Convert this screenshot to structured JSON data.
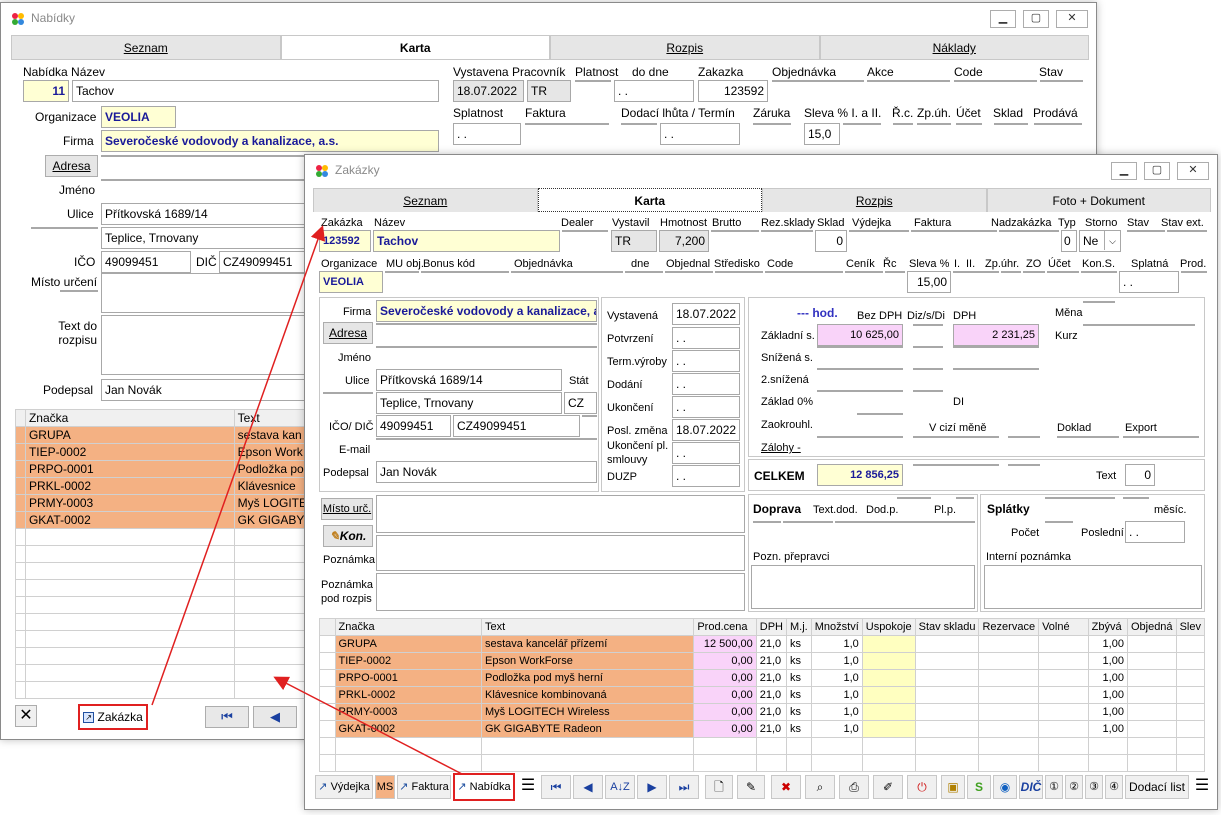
{
  "win1": {
    "title": "Nabídky",
    "tabs": [
      "Seznam",
      "Karta",
      "Rozpis",
      "Náklady"
    ],
    "lbl": {
      "nabidka_nazev": "Nabídka Název",
      "organizace": "Organizace",
      "firma": "Firma",
      "adresa": "Adresa",
      "jmeno": "Jméno",
      "ulice": "Ulice",
      "ico": "IČO",
      "dic": "DIČ",
      "misto": "Místo určení",
      "text_do": "Text do rozpisu",
      "podepsal": "Podepsal",
      "vystavena": "Vystavena",
      "pracovnik": "Pracovník",
      "platnost": "Platnost",
      "do_dne": "do dne",
      "zakazka": "Zakazka",
      "objednavka": "Objednávka",
      "akce": "Akce",
      "code": "Code",
      "stav": "Stav",
      "splatnost": "Splatnost",
      "faktura": "Faktura",
      "dodaci": "Dodací lhůta / Termín",
      "zaruka": "Záruka",
      "sleva": "Sleva % I. a II.",
      "rc": "Ř.c.",
      "zpuh": "Zp.úh.",
      "ucet": "Účet",
      "sklad": "Sklad",
      "prodava": "Prodává"
    },
    "val": {
      "cislo": "11",
      "nazev": "Tachov",
      "organizace": "VEOLIA",
      "firma": "Severočeské vodovody a kanalizace, a.s.",
      "ulice": "Přítkovská 1689/14",
      "mesto": "Teplice, Trnovany",
      "ico": "49099451",
      "dic": "CZ49099451",
      "podepsal": "Jan Novák",
      "vystavena": "18.07.2022",
      "pracovnik": "TR",
      "platnost": ". .",
      "do_dne": ". .",
      "zakazka": "123592",
      "splatnost": ". .",
      "dodaci": ". .",
      "sleva": "15,0"
    },
    "grid_head": [
      "Značka",
      "Text"
    ],
    "rows": [
      [
        "GRUPA",
        "sestava kan"
      ],
      [
        "TIEP-0002",
        "Epson Work"
      ],
      [
        "PRPO-0001",
        "Podložka po"
      ],
      [
        "PRKL-0002",
        "Klávesnice"
      ],
      [
        "PRMY-0003",
        "Myš LOGITE"
      ],
      [
        "GKAT-0002",
        "GK  GIGABY"
      ]
    ],
    "zakazka_btn": "Zakázka"
  },
  "win2": {
    "title": "Zakázky",
    "tabs": [
      "Seznam",
      "Karta",
      "Rozpis",
      "Foto + Dokument"
    ],
    "head1": {
      "zakazka": "Zakázka",
      "nazev": "Název",
      "dealer": "Dealer",
      "vystavil": "Vystavil",
      "hmotnost": "Hmotnost",
      "brutto": "Brutto",
      "rezsklady": "Rez.sklady",
      "sklad": "Sklad",
      "vydejka": "Výdejka",
      "faktura": "Faktura",
      "nadzakazka": "Nadzakázka",
      "typ": "Typ",
      "storno": "Storno",
      "stav": "Stav",
      "stavext": "Stav ext."
    },
    "val1": {
      "zakazka": "123592",
      "nazev": "Tachov",
      "vystavil": "TR",
      "hmotnost": "7,200",
      "sklad": "0",
      "typ": "0",
      "storno": "Ne"
    },
    "head2": {
      "organizace": "Organizace",
      "mu": "MU obj.",
      "bonus": "Bonus kód",
      "objednavka": "Objednávka",
      "dne": "dne",
      "objednal": "Objednal",
      "stredisko": "Středisko",
      "code": "Code",
      "cenik": "Ceník",
      "rc": "Řc",
      "sleva": "Sleva %",
      "i": "I.",
      "ii": "II.",
      "zpuhr": "Zp.úhr.",
      "zo": "ZO",
      "ucet": "Účet",
      "konsym": "Kon.S.",
      "splatna": "Splatná",
      "prod": "Prod."
    },
    "val2": {
      "organizace": "VEOLIA",
      "sleva": "15,00",
      "splatna": ". ."
    },
    "left": {
      "firma_l": "Firma",
      "firma": "Severočeské vodovody a kanalizace, a.",
      "adresa": "Adresa",
      "jmeno": "Jméno",
      "ulice_l": "Ulice",
      "ulice": "Přítkovská 1689/14",
      "stat": "Stát",
      "mesto": "Teplice, Trnovany",
      "statv": "CZ",
      "ico_l": "IČO/ DIČ",
      "ico": "49099451",
      "dic": "CZ49099451",
      "email": "E-mail",
      "podepsal_l": "Podepsal",
      "podepsal": "Jan Novák"
    },
    "dates": [
      [
        "Vystavená",
        "18.07.2022"
      ],
      [
        "Potvrzení",
        ". ."
      ],
      [
        "Term.výroby",
        ". ."
      ],
      [
        "Dodání",
        ". ."
      ],
      [
        "Ukončení",
        ". ."
      ],
      [
        "Posl. změna",
        "18.07.2022"
      ],
      [
        "Ukončení pl. smlouvy",
        ". ."
      ],
      [
        "DUZP",
        ". ."
      ]
    ],
    "price": {
      "hod": "--- hod.",
      "bezdph": "Bez DPH",
      "diz": "Diz/s/Di",
      "dph": "DPH",
      "mena": "Měna",
      "kurz": "Kurz",
      "zakladni": "Základní s.",
      "snizena": "Snížená s.",
      "snizena2": "2.snížená",
      "zaklad0": "Základ 0%",
      "di": "DI",
      "zaokr": "Zaokrouhl.",
      "vcizi": "V cizí měně",
      "doklad": "Doklad",
      "export": "Export",
      "zalohy": "Zálohy  -",
      "zakl_bez": "10 625,00",
      "zakl_dph": "2 231,25",
      "celkem": "CELKEM",
      "celkem_v": "12 856,25",
      "text": "Text",
      "text_v": "0"
    },
    "misto": "Místo urč.",
    "kon": "Kon.",
    "poznamka": "Poznámka",
    "pozn_pod": "Poznámka pod rozpis",
    "doprava": {
      "doprava": "Doprava",
      "textdod": "Text.dod.",
      "dodp": "Dod.p.",
      "plp": "Pl.p.",
      "splatky": "Splátky",
      "mesic": "měsíc.",
      "pocet": "Počet",
      "posledni": "Poslední",
      "posl_v": ". .",
      "pozn_prep": "Pozn. přepravci",
      "int_pozn": "Interní poznámka"
    },
    "grid_head": [
      "Značka",
      "Text",
      "Prod.cena",
      "DPH",
      "M.j.",
      "Množství",
      "Uspokoje",
      "Stav skladu",
      "Rezervace",
      "Volné",
      "Zbývá",
      "Objedná",
      "Slev"
    ],
    "rows": [
      [
        "GRUPA",
        "sestava kancelář přízemí",
        "12 500,00",
        "21,0",
        "ks",
        "1,0",
        "1,00"
      ],
      [
        "TIEP-0002",
        "Epson WorkForse",
        "0,00",
        "21,0",
        "ks",
        "1,0",
        "1,00"
      ],
      [
        "PRPO-0001",
        "Podložka pod myš herní",
        "0,00",
        "21,0",
        "ks",
        "1,0",
        "1,00"
      ],
      [
        "PRKL-0002",
        "Klávesnice kombinovaná",
        "0,00",
        "21,0",
        "ks",
        "1,0",
        "1,00"
      ],
      [
        "PRMY-0003",
        "Myš LOGITECH Wireless",
        "0,00",
        "21,0",
        "ks",
        "1,0",
        "1,00"
      ],
      [
        "GKAT-0002",
        "GK  GIGABYTE Radeon",
        "0,00",
        "21,0",
        "ks",
        "1,0",
        "1,00"
      ]
    ],
    "toolbar": {
      "vydejka": "Výdejka",
      "ms": "MS",
      "faktura": "Faktura",
      "nabidka": "Nabídka",
      "dic": "DIČ",
      "dodaci": "Dodací list"
    }
  },
  "colors": {
    "salmon": "#f4b183",
    "pink": "#f9d3f9",
    "yellow": "#ffffd4",
    "green": "#c6efce",
    "blue": "#ddebf7",
    "peach": "#fce4d6",
    "red": "#e02020"
  }
}
